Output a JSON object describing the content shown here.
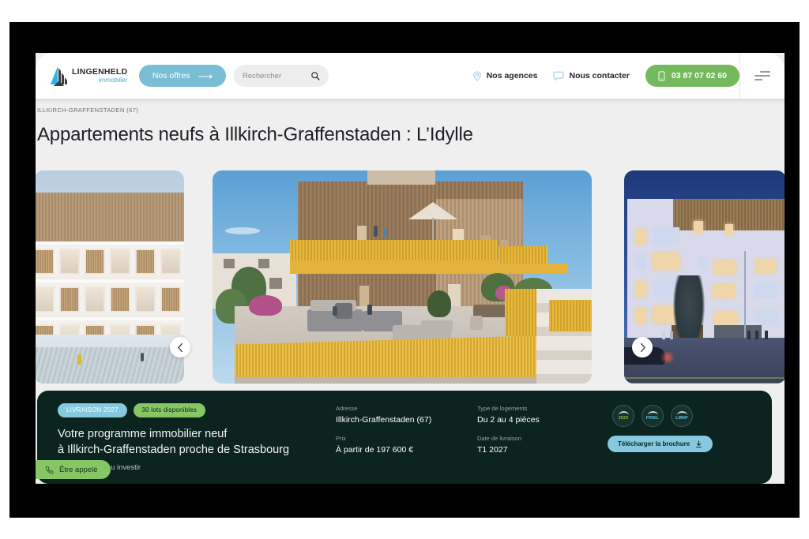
{
  "brand": {
    "name": "LINGENHELD",
    "tagline": "immobilier",
    "logo_color": "#3fa9d6"
  },
  "nav": {
    "offers_label": "Nos offres",
    "offers_arrow": "⟶",
    "search_placeholder": "Rechercher",
    "search_icon": "magnifier-icon",
    "agencies_label": "Nos agences",
    "agencies_icon": "map-pin-icon",
    "contact_label": "Nous contacter",
    "contact_icon": "chat-bubble-icon",
    "phone_label": "03 87 07 02 60",
    "phone_icon": "mobile-phone-icon",
    "phone_bg": "#74b95c",
    "menu_icon": "hamburger-menu-icon"
  },
  "page": {
    "breadcrumb": "ILLKIRCH-GRAFFENSTADEN (67)",
    "title": "Appartements neufs à Illkirch-Graffenstaden : L’Idylle"
  },
  "carousel": {
    "prev_icon": "chevron-left-icon",
    "next_icon": "chevron-right-icon",
    "slides": [
      {
        "name": "facade-winter-daytime"
      },
      {
        "name": "rooftop-terrace-hero"
      },
      {
        "name": "street-view-dusk"
      }
    ]
  },
  "info": {
    "tag_delivery": "LIVRAISON 2027",
    "tag_lots": "30 lots disponibles",
    "headline": "Votre programme immobilier neuf\nà Illkirch-Graffenstaden proche de Strasbourg",
    "subtitle": "Pour y habiter ou investir",
    "fields": {
      "address_label": "Adresse",
      "address_value": "Illkirch-Graffenstaden (67)",
      "price_label": "Prix",
      "price_value": "À partir de 197 600 €",
      "type_label": "Type de logements",
      "type_value": "Du 2 au 4 pièces",
      "delivery_label": "Date de livraison",
      "delivery_value": "T1 2027"
    },
    "badges": [
      {
        "name": "re2020-badge",
        "text": "2020"
      },
      {
        "name": "pinel-badge",
        "text": "PINEL"
      },
      {
        "name": "lmnp-badge",
        "text": "LMNP"
      }
    ],
    "brochure_label": "Télécharger la brochure",
    "brochure_icon": "download-icon",
    "panel_bg": "#0b2420"
  },
  "cta": {
    "call_label": "Être appelé",
    "call_icon": "phone-callback-icon",
    "call_bg": "#86c664"
  }
}
